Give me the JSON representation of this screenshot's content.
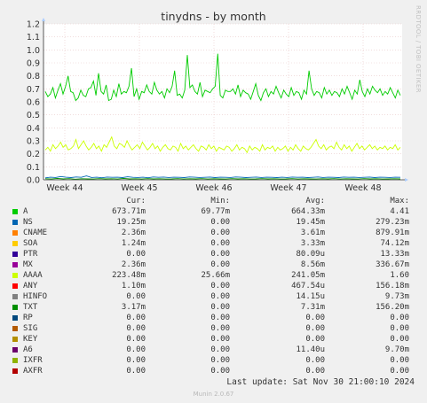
{
  "title": "tinydns - by month",
  "side_label": "RRDTOOL / TOBI OETIKER",
  "footer": {
    "last_update": "Last update: Sat Nov 30 21:00:10 2024",
    "version": "Munin 2.0.67"
  },
  "legend_header": {
    "cur": "Cur:",
    "min": "Min:",
    "avg": "Avg:",
    "max": "Max:"
  },
  "legend": [
    {
      "name": "A",
      "color": "#00cc00",
      "cur": "673.71m",
      "min": "69.77m",
      "avg": "664.33m",
      "max": "4.41"
    },
    {
      "name": "NS",
      "color": "#0066b3",
      "cur": "19.25m",
      "min": "0.00",
      "avg": "19.45m",
      "max": "279.23m"
    },
    {
      "name": "CNAME",
      "color": "#ff8000",
      "cur": "2.36m",
      "min": "0.00",
      "avg": "3.61m",
      "max": "879.91m"
    },
    {
      "name": "SOA",
      "color": "#ffcc00",
      "cur": "1.24m",
      "min": "0.00",
      "avg": "3.33m",
      "max": "74.12m"
    },
    {
      "name": "PTR",
      "color": "#330099",
      "cur": "0.00",
      "min": "0.00",
      "avg": "80.09u",
      "max": "13.33m"
    },
    {
      "name": "MX",
      "color": "#990099",
      "cur": "2.36m",
      "min": "0.00",
      "avg": "8.56m",
      "max": "336.67m"
    },
    {
      "name": "AAAA",
      "color": "#ccff00",
      "cur": "223.48m",
      "min": "25.66m",
      "avg": "241.05m",
      "max": "1.60"
    },
    {
      "name": "ANY",
      "color": "#ff0000",
      "cur": "1.10m",
      "min": "0.00",
      "avg": "467.54u",
      "max": "156.18m"
    },
    {
      "name": "HINFO",
      "color": "#808080",
      "cur": "0.00",
      "min": "0.00",
      "avg": "14.15u",
      "max": "9.73m"
    },
    {
      "name": "TXT",
      "color": "#008f00",
      "cur": "3.17m",
      "min": "0.00",
      "avg": "7.31m",
      "max": "156.20m"
    },
    {
      "name": "RP",
      "color": "#00487d",
      "cur": "0.00",
      "min": "0.00",
      "avg": "0.00",
      "max": "0.00"
    },
    {
      "name": "SIG",
      "color": "#b35a00",
      "cur": "0.00",
      "min": "0.00",
      "avg": "0.00",
      "max": "0.00"
    },
    {
      "name": "KEY",
      "color": "#b38f00",
      "cur": "0.00",
      "min": "0.00",
      "avg": "0.00",
      "max": "0.00"
    },
    {
      "name": "A6",
      "color": "#6b006b",
      "cur": "0.00",
      "min": "0.00",
      "avg": "11.40u",
      "max": "9.70m"
    },
    {
      "name": "IXFR",
      "color": "#8fb300",
      "cur": "0.00",
      "min": "0.00",
      "avg": "0.00",
      "max": "0.00"
    },
    {
      "name": "AXFR",
      "color": "#b30000",
      "cur": "0.00",
      "min": "0.00",
      "avg": "0.00",
      "max": "0.00"
    }
  ],
  "chart_data": {
    "type": "line",
    "title": "tinydns - by month",
    "x_ticks": [
      "Week 44",
      "Week 45",
      "Week 46",
      "Week 47",
      "Week 48"
    ],
    "y_ticks": [
      "0.0",
      "0.1",
      "0.2",
      "0.3",
      "0.4",
      "0.5",
      "0.6",
      "0.7",
      "0.8",
      "0.9",
      "1.0",
      "1.1",
      "1.2"
    ],
    "ylim": [
      0,
      1.2
    ],
    "grid": true,
    "series": [
      {
        "name": "A",
        "color": "#00cc00",
        "values": [
          0.68,
          0.64,
          0.66,
          0.71,
          0.63,
          0.69,
          0.74,
          0.66,
          0.72,
          0.8,
          0.68,
          0.67,
          0.61,
          0.63,
          0.69,
          0.65,
          0.64,
          0.7,
          0.71,
          0.76,
          0.65,
          0.82,
          0.68,
          0.66,
          0.73,
          0.61,
          0.62,
          0.69,
          0.64,
          0.74,
          0.66,
          0.68,
          0.67,
          0.72,
          0.86,
          0.64,
          0.7,
          0.62,
          0.68,
          0.67,
          0.73,
          0.68,
          0.66,
          0.75,
          0.69,
          0.66,
          0.68,
          0.63,
          0.7,
          0.67,
          0.72,
          0.84,
          0.65,
          0.66,
          0.63,
          0.69,
          0.96,
          0.71,
          0.73,
          0.68,
          0.66,
          0.75,
          0.64,
          0.69,
          0.68,
          0.67,
          0.7,
          0.72,
          0.97,
          0.65,
          0.63,
          0.69,
          0.68,
          0.68,
          0.7,
          0.66,
          0.73,
          0.64,
          0.69,
          0.67,
          0.66,
          0.62,
          0.68,
          0.74,
          0.65,
          0.61,
          0.67,
          0.7,
          0.64,
          0.68,
          0.66,
          0.72,
          0.67,
          0.63,
          0.69,
          0.66,
          0.64,
          0.71,
          0.65,
          0.68,
          0.67,
          0.62,
          0.69,
          0.66,
          0.84,
          0.7,
          0.65,
          0.68,
          0.67,
          0.63,
          0.71,
          0.66,
          0.69,
          0.65,
          0.68,
          0.67,
          0.64,
          0.7,
          0.66,
          0.72,
          0.67,
          0.62,
          0.69,
          0.66,
          0.77,
          0.68,
          0.64,
          0.7,
          0.66,
          0.72,
          0.69,
          0.67,
          0.7,
          0.65,
          0.68,
          0.66,
          0.71,
          0.67,
          0.63,
          0.69,
          0.65
        ]
      },
      {
        "name": "AAAA",
        "color": "#ccff00",
        "values": [
          0.23,
          0.25,
          0.22,
          0.27,
          0.24,
          0.26,
          0.29,
          0.25,
          0.27,
          0.23,
          0.24,
          0.26,
          0.31,
          0.24,
          0.27,
          0.3,
          0.26,
          0.23,
          0.25,
          0.28,
          0.24,
          0.26,
          0.22,
          0.27,
          0.25,
          0.29,
          0.33,
          0.26,
          0.24,
          0.28,
          0.27,
          0.25,
          0.3,
          0.26,
          0.23,
          0.25,
          0.27,
          0.24,
          0.29,
          0.26,
          0.23,
          0.25,
          0.28,
          0.24,
          0.26,
          0.22,
          0.25,
          0.27,
          0.24,
          0.23,
          0.26,
          0.25,
          0.22,
          0.28,
          0.24,
          0.26,
          0.23,
          0.25,
          0.27,
          0.24,
          0.22,
          0.26,
          0.25,
          0.23,
          0.27,
          0.24,
          0.26,
          0.22,
          0.25,
          0.24,
          0.23,
          0.26,
          0.25,
          0.22,
          0.24,
          0.27,
          0.23,
          0.25,
          0.24,
          0.21,
          0.26,
          0.23,
          0.25,
          0.24,
          0.22,
          0.27,
          0.23,
          0.25,
          0.24,
          0.26,
          0.22,
          0.25,
          0.23,
          0.24,
          0.26,
          0.22,
          0.25,
          0.23,
          0.27,
          0.24,
          0.22,
          0.26,
          0.24,
          0.23,
          0.25,
          0.28,
          0.31,
          0.26,
          0.24,
          0.27,
          0.23,
          0.25,
          0.26,
          0.24,
          0.29,
          0.25,
          0.23,
          0.27,
          0.24,
          0.26,
          0.22,
          0.25,
          0.28,
          0.24,
          0.26,
          0.23,
          0.25,
          0.27,
          0.24,
          0.26,
          0.23,
          0.25,
          0.24,
          0.26,
          0.23,
          0.25,
          0.24,
          0.27,
          0.23,
          0.25
        ]
      },
      {
        "name": "NS",
        "color": "#0066b3",
        "values": [
          0.015,
          0.02,
          0.018,
          0.025,
          0.02,
          0.017,
          0.022,
          0.019,
          0.03,
          0.018,
          0.02,
          0.016,
          0.021,
          0.019,
          0.02,
          0.017,
          0.023,
          0.019,
          0.018,
          0.02,
          0.016,
          0.022,
          0.019,
          0.021,
          0.018,
          0.02,
          0.019,
          0.017,
          0.022,
          0.02,
          0.018,
          0.019,
          0.021,
          0.017,
          0.02,
          0.019,
          0.018,
          0.022,
          0.02,
          0.017,
          0.019,
          0.021,
          0.018,
          0.02,
          0.019,
          0.017,
          0.02,
          0.018,
          0.021,
          0.019,
          0.02,
          0.017,
          0.019,
          0.022,
          0.018,
          0.02,
          0.019,
          0.017,
          0.021,
          0.019,
          0.02,
          0.018,
          0.019,
          0.021,
          0.017,
          0.02,
          0.019,
          0.018,
          0.02,
          0.019
        ]
      },
      {
        "name": "TXT",
        "color": "#008f00",
        "values": [
          0.008,
          0.006,
          0.01,
          0.007,
          0.009,
          0.005,
          0.008,
          0.007,
          0.006,
          0.009,
          0.007,
          0.008,
          0.006,
          0.01,
          0.007,
          0.008,
          0.006,
          0.009,
          0.007,
          0.008,
          0.006,
          0.007,
          0.009,
          0.006,
          0.008,
          0.007,
          0.009,
          0.006,
          0.008,
          0.007,
          0.006,
          0.009,
          0.007,
          0.008,
          0.006,
          0.007,
          0.009,
          0.007,
          0.008,
          0.006,
          0.007,
          0.009,
          0.006,
          0.008,
          0.007,
          0.006,
          0.008,
          0.007,
          0.009,
          0.006,
          0.008,
          0.007,
          0.006,
          0.009,
          0.007,
          0.008,
          0.006,
          0.007,
          0.008,
          0.007
        ]
      }
    ]
  }
}
